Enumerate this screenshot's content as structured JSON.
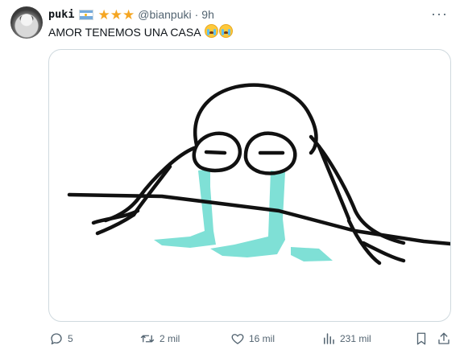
{
  "tweet": {
    "display_name": "puki",
    "handle": "@bianpuki",
    "separator": "·",
    "time": "9h",
    "stars": "★★★",
    "text": "AMOR TENEMOS UNA CASA",
    "emoji_count": 2,
    "more_label": "···"
  },
  "actions": {
    "replies": "5",
    "retweets": "2 mil",
    "likes": "16 mil",
    "views": "231 mil"
  },
  "icons": {
    "avatar": "avatar-cat",
    "flag": "argentina-flag-icon",
    "verified": "star-icons",
    "more": "more-icon",
    "reply": "reply-icon",
    "retweet": "retweet-icon",
    "like": "heart-icon",
    "views": "views-icon",
    "bookmark": "bookmark-icon",
    "share": "share-icon"
  },
  "colors": {
    "text": "#0f1419",
    "secondary": "#536471",
    "border": "#cfd9de",
    "star": "#f5a623",
    "tears": "#7fe0d6"
  }
}
